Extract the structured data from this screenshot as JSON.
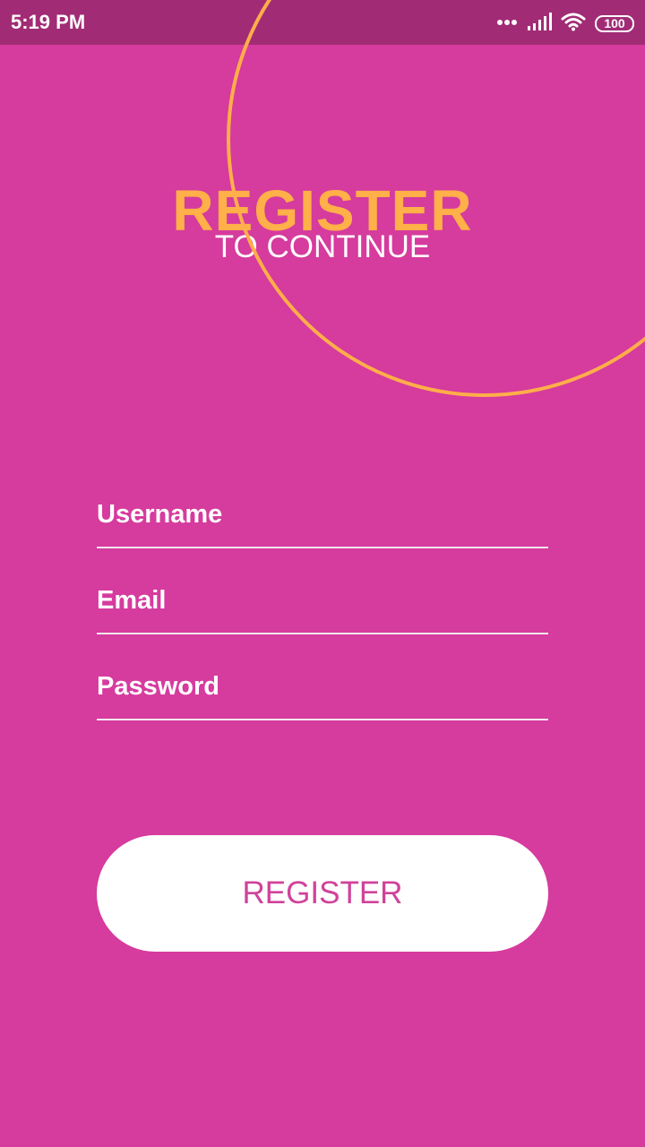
{
  "status_bar": {
    "time": "5:19 PM",
    "battery": "100",
    "icons": [
      "more-dots-icon",
      "cellular-signal-icon",
      "wifi-icon",
      "battery-icon"
    ]
  },
  "header": {
    "title": "REGISTER",
    "subtitle": "TO CONTINUE"
  },
  "form": {
    "username_placeholder": "Username",
    "username_value": "",
    "email_placeholder": "Email",
    "email_value": "",
    "password_placeholder": "Password",
    "password_value": ""
  },
  "register_button": {
    "label": "REGISTER"
  },
  "colors": {
    "background": "#D63B9E",
    "status_bar": "#A12C75",
    "accent": "#FFB049",
    "button": "#FFFFFF",
    "button_text": "#D0429A"
  }
}
